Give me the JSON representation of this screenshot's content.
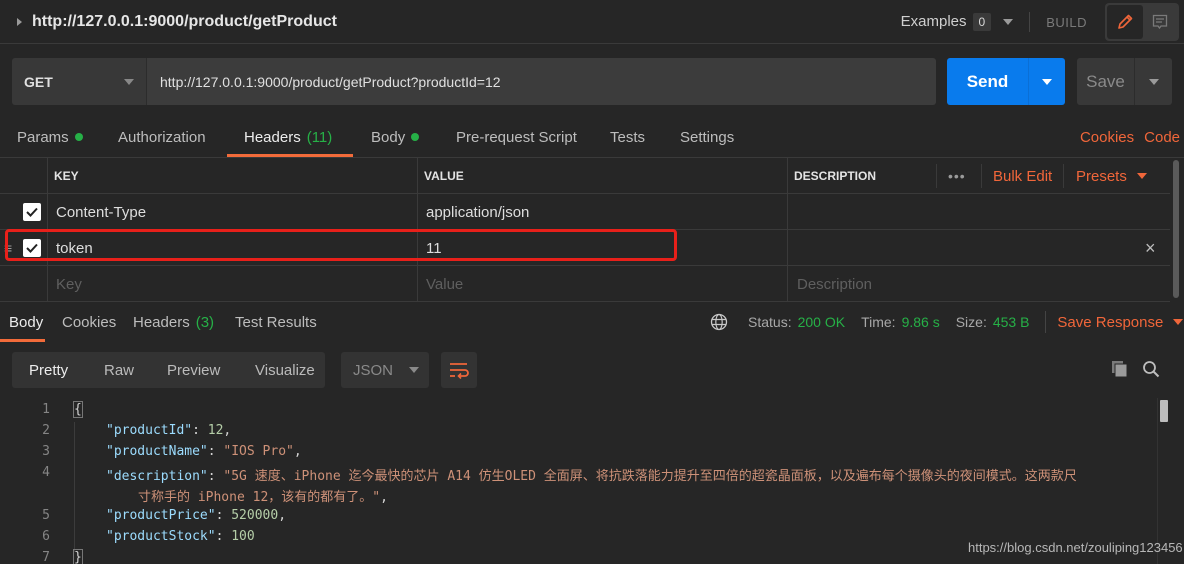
{
  "title_bar": {
    "request_name": "http://127.0.0.1:9000/product/getProduct",
    "examples_label": "Examples",
    "examples_count": "0",
    "build_label": "BUILD",
    "edit_icon": "pencil-icon",
    "comments_icon": "comment-icon"
  },
  "request": {
    "method": "GET",
    "url": "http://127.0.0.1:9000/product/getProduct?productId=12",
    "send_label": "Send",
    "save_label": "Save"
  },
  "request_tabs": {
    "items": [
      {
        "label": "Params",
        "indicator": "dot"
      },
      {
        "label": "Authorization"
      },
      {
        "label": "Headers",
        "count": "(11)",
        "active": true
      },
      {
        "label": "Body",
        "indicator": "dot"
      },
      {
        "label": "Pre-request Script"
      },
      {
        "label": "Tests"
      },
      {
        "label": "Settings"
      }
    ],
    "cookies_link": "Cookies",
    "code_link": "Code"
  },
  "headers_table": {
    "columns": [
      "KEY",
      "VALUE",
      "DESCRIPTION"
    ],
    "more_label": "•••",
    "bulk_edit_label": "Bulk Edit",
    "presets_label": "Presets",
    "rows": [
      {
        "checked": true,
        "key": "Content-Type",
        "value": "application/json",
        "description": ""
      },
      {
        "checked": true,
        "key": "token",
        "value": "11",
        "description": "",
        "highlighted": true
      }
    ],
    "placeholders": {
      "key": "Key",
      "value": "Value",
      "description": "Description"
    }
  },
  "response": {
    "tabs": [
      {
        "label": "Body",
        "active": true
      },
      {
        "label": "Cookies"
      },
      {
        "label": "Headers",
        "count": "(3)"
      },
      {
        "label": "Test Results"
      }
    ],
    "status_label": "Status:",
    "status_value": "200 OK",
    "time_label": "Time:",
    "time_value": "9.86 s",
    "size_label": "Size:",
    "size_value": "453 B",
    "save_response_label": "Save Response",
    "view_modes": [
      "Pretty",
      "Raw",
      "Preview",
      "Visualize"
    ],
    "active_view": "Pretty",
    "format": "JSON",
    "body_lines": [
      {
        "n": "1",
        "text": "{"
      },
      {
        "n": "2",
        "key": "\"productId\"",
        "value": "12",
        "type": "number",
        "trail": ","
      },
      {
        "n": "3",
        "key": "\"productName\"",
        "value": "\"IOS Pro\"",
        "type": "string",
        "trail": ","
      },
      {
        "n": "4",
        "key": "\"description\"",
        "value": "\"5G 速度、iPhone 迄今最快的芯片 A14 仿生OLED 全面屏、将抗跌落能力提升至四倍的超瓷晶面板，以及遍布每个摄像头的夜间模式。这两款尺",
        "type": "string",
        "trail": ""
      },
      {
        "n": "",
        "cont": "寸称手的 iPhone 12，该有的都有了。\"",
        "trail": ","
      },
      {
        "n": "5",
        "key": "\"productPrice\"",
        "value": "520000",
        "type": "number",
        "trail": ","
      },
      {
        "n": "6",
        "key": "\"productStock\"",
        "value": "100",
        "type": "number",
        "trail": ""
      },
      {
        "n": "7",
        "text": "}"
      }
    ]
  },
  "watermark": "https://blog.csdn.net/zouliping123456"
}
